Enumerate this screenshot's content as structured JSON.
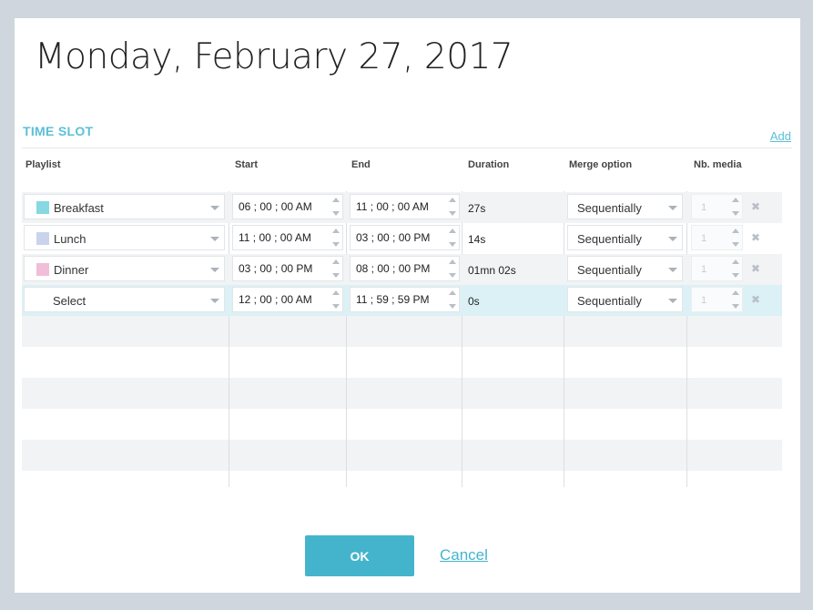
{
  "dialog": {
    "title": "Monday, February 27, 2017",
    "section_title": "TIME SLOT",
    "add_label": "Add"
  },
  "columns": {
    "playlist": "Playlist",
    "start": "Start",
    "end": "End",
    "duration": "Duration",
    "merge": "Merge option",
    "nb_media": "Nb. media"
  },
  "rows": [
    {
      "playlist": "Breakfast",
      "color": "#86d8e1",
      "start": "06 ; 00 ; 00 AM",
      "end": "11 ; 00 ; 00 AM",
      "duration": "27s",
      "merge": "Sequentially",
      "nb_media": "1"
    },
    {
      "playlist": "Lunch",
      "color": "#c9d4ec",
      "start": "11 ; 00 ; 00 AM",
      "end": "03 ; 00 ; 00 PM",
      "duration": "14s",
      "merge": "Sequentially",
      "nb_media": "1"
    },
    {
      "playlist": "Dinner",
      "color": "#f0bed8",
      "start": "03 ; 00 ; 00 PM",
      "end": "08 ; 00 ; 00 PM",
      "duration": "01mn 02s",
      "merge": "Sequentially",
      "nb_media": "1"
    },
    {
      "playlist": "Select",
      "color": "",
      "start": "12 ; 00 ; 00 AM",
      "end": "11 ; 59 ; 59 PM",
      "duration": "0s",
      "merge": "Sequentially",
      "nb_media": "1"
    }
  ],
  "buttons": {
    "ok": "OK",
    "cancel": "Cancel"
  },
  "colors": {
    "accent": "#44b4cc",
    "selected_row": "#dcf1f5",
    "stripe": "#f1f3f5"
  }
}
